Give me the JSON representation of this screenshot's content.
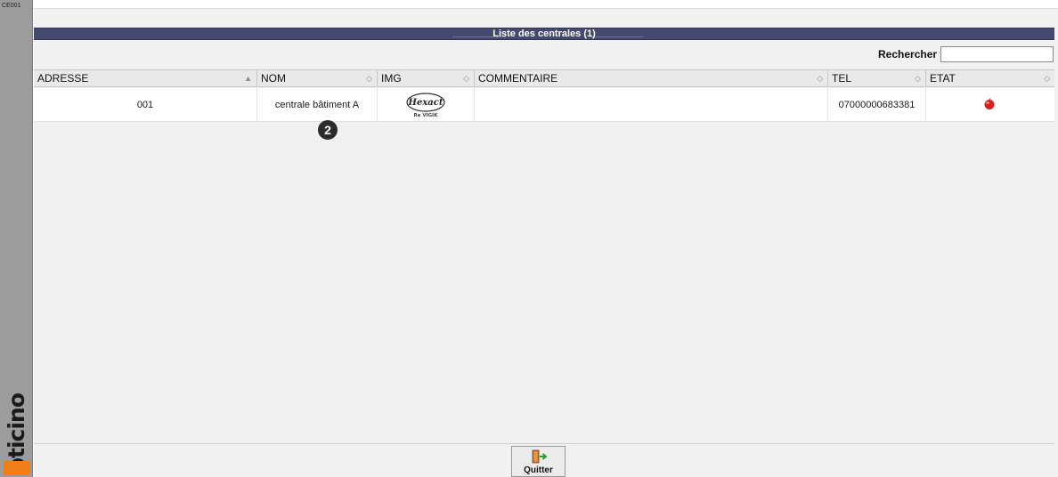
{
  "sidebar": {
    "screen_code": "CE001",
    "brand": "bticino"
  },
  "window": {
    "title": "Liste des centrales (1)"
  },
  "search": {
    "label": "Rechercher",
    "value": "",
    "placeholder": ""
  },
  "table": {
    "columns": [
      {
        "key": "adresse",
        "label": "ADRESSE",
        "sort": "▲"
      },
      {
        "key": "nom",
        "label": "NOM",
        "sort": "◇"
      },
      {
        "key": "img",
        "label": "IMG",
        "sort": "◇"
      },
      {
        "key": "commentaire",
        "label": "COMMENTAIRE",
        "sort": "◇"
      },
      {
        "key": "tel",
        "label": "TEL",
        "sort": "◇"
      },
      {
        "key": "etat",
        "label": "ETAT",
        "sort": "◇"
      }
    ],
    "rows": [
      {
        "adresse": "001",
        "nom": "centrale bâtiment A",
        "img": {
          "logo_text": "Hexact",
          "logo_sub": "Re VIGIK"
        },
        "commentaire": "",
        "tel": "07000000683381",
        "etat": {
          "icon": "status-red-ball-icon",
          "color": "#d8201e"
        }
      }
    ]
  },
  "callout": {
    "number": "2"
  },
  "footer": {
    "quit_label": "Quitter",
    "quit_icon": "exit-door-icon"
  },
  "colors": {
    "titlebar": "#45496e",
    "brand_orange": "#f07e1a",
    "status_red": "#d8201e"
  }
}
